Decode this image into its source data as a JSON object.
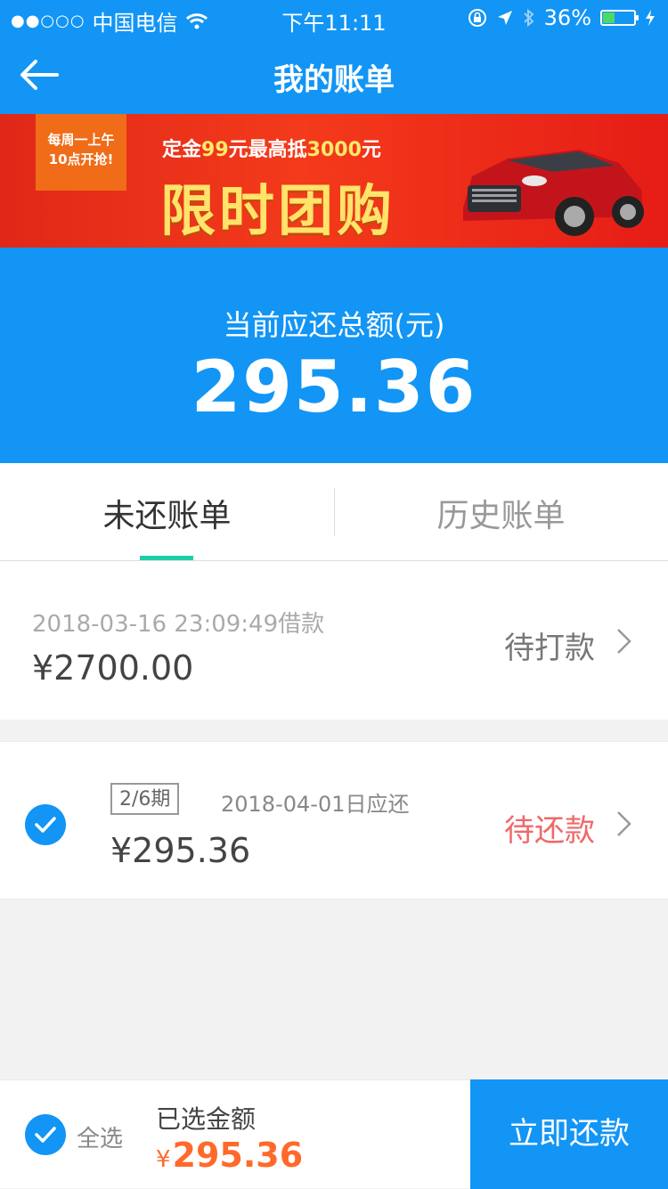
{
  "statusbar": {
    "carrier": "中国电信",
    "time": "下午11:11",
    "battery": "36%"
  },
  "navbar": {
    "title": "我的账单"
  },
  "banner": {
    "ribbon_line1": "每周一上午",
    "ribbon_line2": "10点开抢!",
    "sub_a": "定金",
    "sub_b": "99",
    "sub_c": "元最高抵",
    "sub_d": "3000",
    "sub_e": "元",
    "main": "限时团购"
  },
  "summary": {
    "label": "当前应还总额(元)",
    "amount": "295.36"
  },
  "tabs": [
    {
      "label": "未还账单"
    },
    {
      "label": "历史账单"
    }
  ],
  "bills": [
    {
      "date": "2018-03-16 23:09:49借款",
      "amount": "¥2700.00",
      "status": "待打款"
    },
    {
      "period": "2/6期",
      "due": "2018-04-01日应还",
      "amount": "¥295.36",
      "status": "待还款"
    }
  ],
  "footer": {
    "select_all": "全选",
    "selected_label": "已选金额",
    "currency": "¥",
    "selected_amount": "295.36",
    "pay_button": "立即还款"
  },
  "colors": {
    "primary": "#1295f5",
    "accent_green": "#1dcfa6",
    "pending_red": "#ef6969",
    "amount_orange": "#ff6a2a"
  }
}
